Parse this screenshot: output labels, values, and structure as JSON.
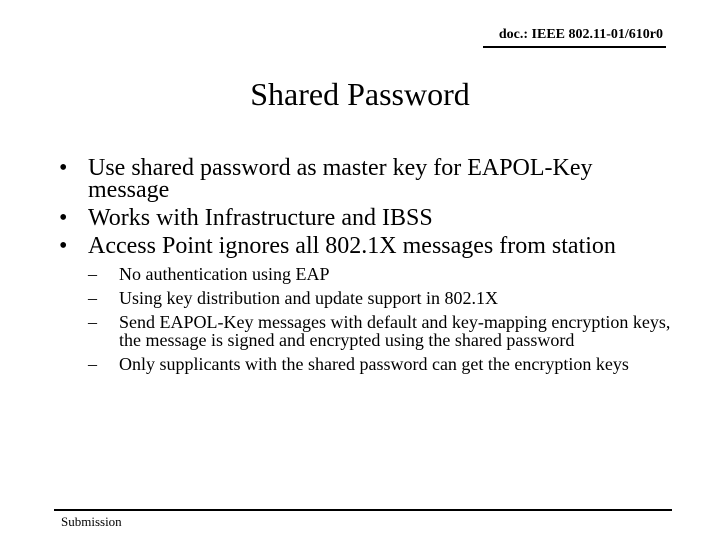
{
  "header": {
    "doc_id": "doc.: IEEE 802.11-01/610r0"
  },
  "slide": {
    "title": "Shared Password",
    "bullets": [
      {
        "text": "Use shared password as master key for EAPOL-Key message"
      },
      {
        "text": "Works with Infrastructure and IBSS"
      },
      {
        "text": "Access Point ignores all 802.1X messages from station",
        "subitems": [
          "No authentication using EAP",
          "Using key distribution and update support in 802.1X",
          "Send EAPOL-Key messages with default and key-mapping encryption keys, the message is signed and encrypted using the shared password",
          "Only supplicants with the shared password can get the encryption keys"
        ]
      }
    ],
    "bullet_marker": "•",
    "sub_marker": "–"
  },
  "footer": {
    "label": "Submission"
  }
}
